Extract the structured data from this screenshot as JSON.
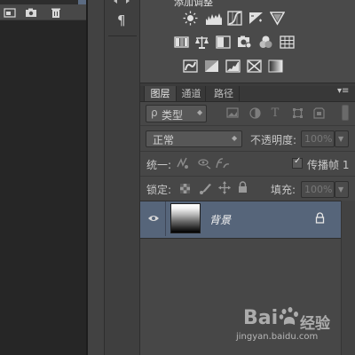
{
  "adjustments": {
    "title": "添加调整"
  },
  "narrow_column": {
    "icons": [
      "arrows-icon",
      "paragraph-icon"
    ],
    "paragraph_glyph": "¶"
  },
  "layers_panel": {
    "tabs": [
      "图层",
      "通道",
      "路径"
    ],
    "active_tab": "图层",
    "menu_glyph": "▾≡",
    "filter": {
      "kind_label": "类型",
      "search_glyph": "ρ"
    },
    "filter_icons": [
      "image-filter-icon",
      "adjustment-filter-icon",
      "type-filter-icon",
      "shape-filter-icon",
      "smart-object-filter-icon"
    ],
    "blend_mode": "正常",
    "opacity_label": "不透明度:",
    "opacity_value": "100%",
    "unify_label": "统一:",
    "propagate_label": "传播帧 1",
    "propagate_checked": true,
    "lock_label": "锁定:",
    "fill_label": "填充:",
    "fill_value": "100%",
    "layer": {
      "name": "背景",
      "visible": true,
      "locked": true
    }
  },
  "watermark": {
    "logo": "Bai",
    "logo_suffix": "经验",
    "url": "jingyan.baidu.com"
  },
  "colors": {
    "selected_layer": "#56657a",
    "panel_bg": "#474747",
    "adjust_bg": "#4a4a4a"
  }
}
